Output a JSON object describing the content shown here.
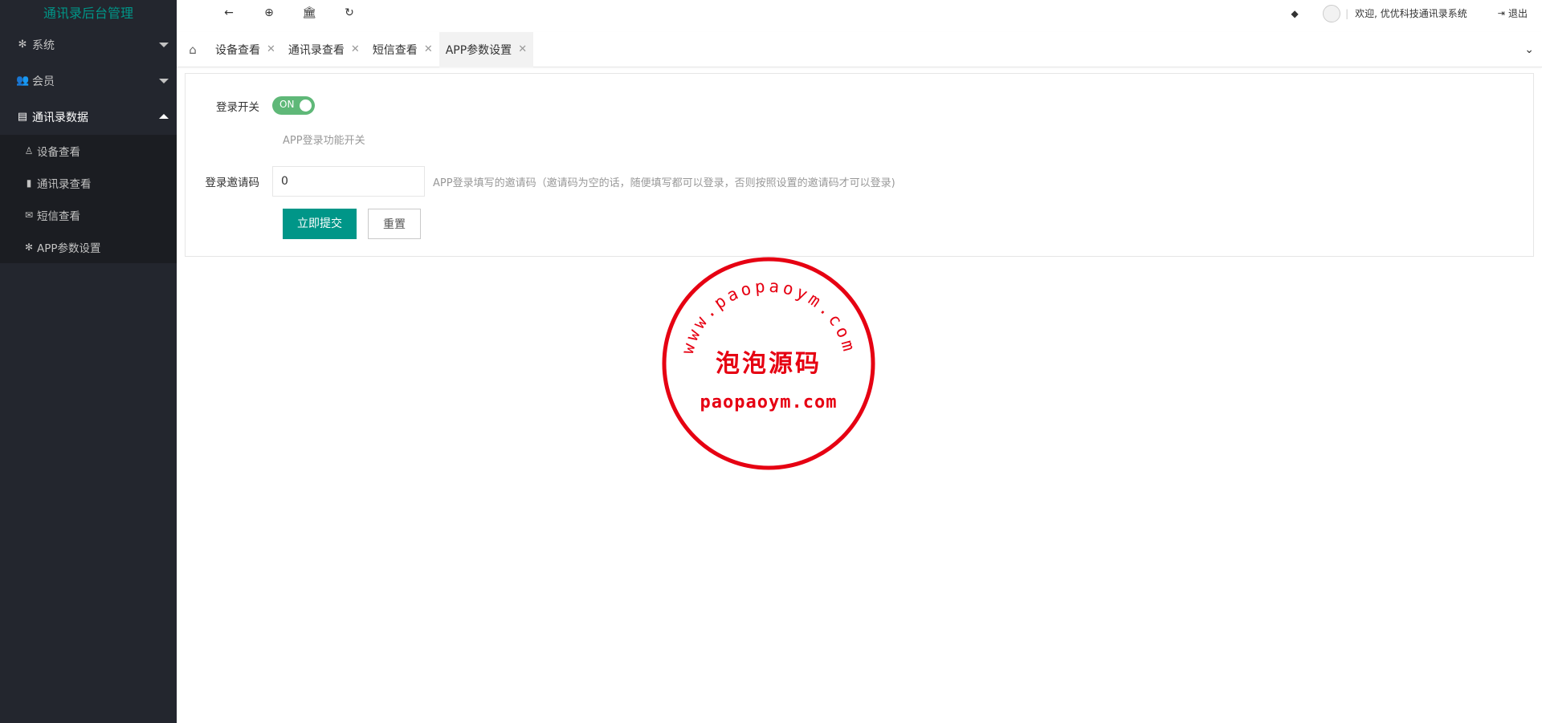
{
  "app": {
    "title": "通讯录后台管理"
  },
  "sidebar": {
    "groups": [
      {
        "label": "系统",
        "icon": "gear-icon"
      },
      {
        "label": "会员",
        "icon": "users-icon"
      },
      {
        "label": "通讯录数据",
        "icon": "id-card-icon"
      }
    ],
    "sub_items": [
      {
        "label": "设备查看",
        "icon": "user-icon"
      },
      {
        "label": "通讯录查看",
        "icon": "book-icon"
      },
      {
        "label": "短信查看",
        "icon": "envelope-icon"
      },
      {
        "label": "APP参数设置",
        "icon": "gear-icon"
      }
    ]
  },
  "header": {
    "welcome": "欢迎, 优优科技通讯录系统",
    "separator": "|",
    "logout": "退出"
  },
  "tabs": [
    {
      "label": "设备查看",
      "active": false
    },
    {
      "label": "通讯录查看",
      "active": false
    },
    {
      "label": "短信查看",
      "active": false
    },
    {
      "label": "APP参数设置",
      "active": true
    }
  ],
  "form": {
    "login_switch": {
      "label": "登录开关",
      "state_text": "ON",
      "help": "APP登录功能开关"
    },
    "invite_code": {
      "label": "登录邀请码",
      "value": "0",
      "help": "APP登录填写的邀请码（邀请码为空的话，随便填写都可以登录，否则按照设置的邀请码才可以登录)"
    },
    "submit_label": "立即提交",
    "reset_label": "重置"
  },
  "watermark": {
    "arc_text": "www.paopaoym.com",
    "center_text": "泡泡源码",
    "bottom_text": "paopaoym.com"
  },
  "colors": {
    "sidebar_bg": "#23262e",
    "accent": "#009688",
    "switch_on": "#5fb878",
    "stamp_red": "#e60012"
  }
}
